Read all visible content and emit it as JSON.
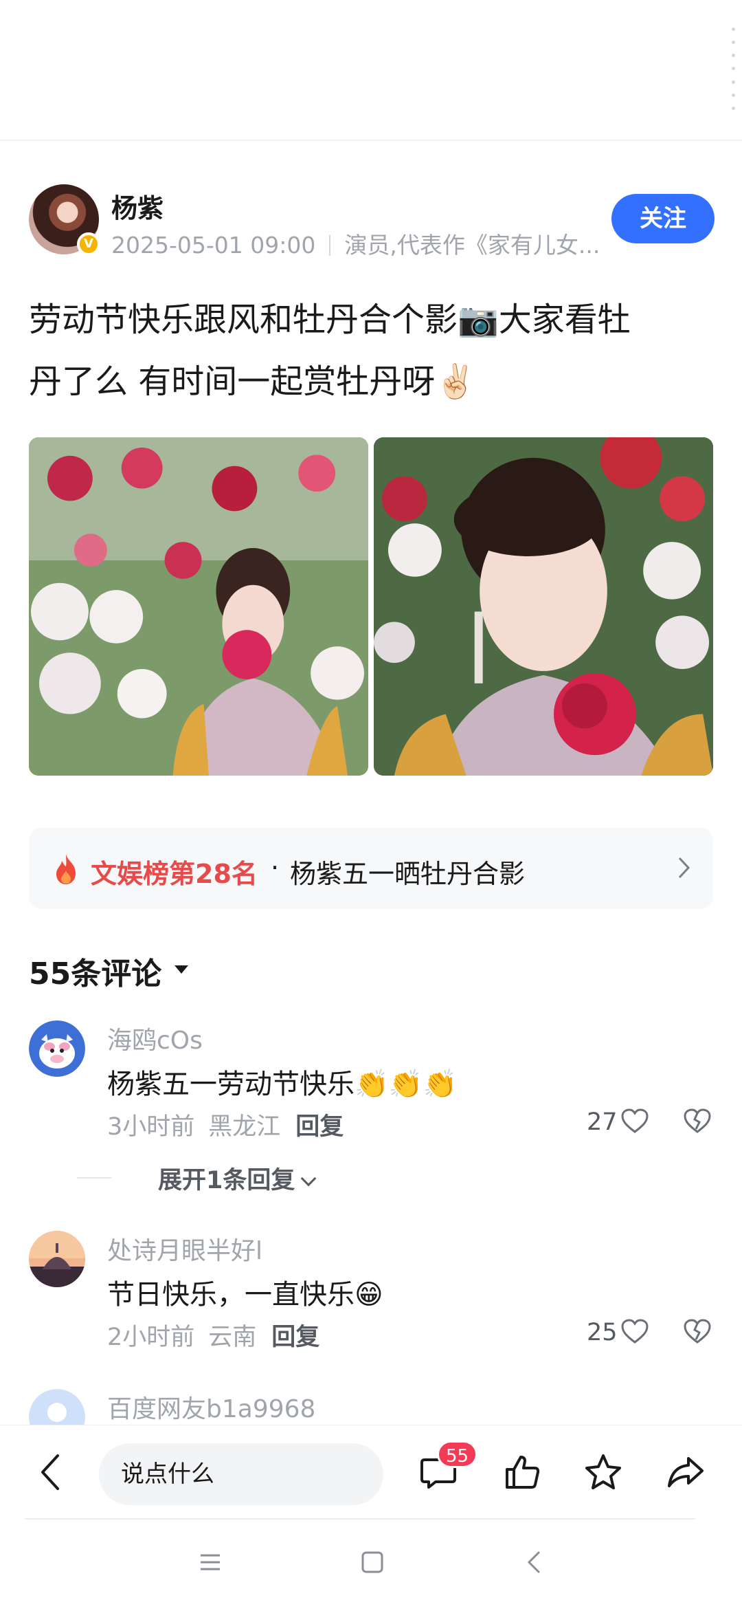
{
  "author": {
    "name": "杨紫",
    "timestamp": "2025-05-01 09:00",
    "description": "演员,代表作《家有儿女...",
    "follow_label": "关注",
    "verified_icon": "verified-badge-icon"
  },
  "post": {
    "text_line1": "劳动节快乐跟风和牡丹合个影📷大家看牡",
    "text_line2": "丹了么 有时间一起赏牡丹呀✌🏻"
  },
  "hot": {
    "rank_label": "文娱榜第28名",
    "separator": "·",
    "topic": "杨紫五一晒牡丹合影"
  },
  "comments_section": {
    "title": "55条评论",
    "expand_label": "展开1条回复"
  },
  "comments": [
    {
      "user": "海鸥cOs",
      "text": "杨紫五一劳动节快乐👏👏👏",
      "time": "3小时前",
      "location": "黑龙江",
      "reply_label": "回复",
      "likes": "27"
    },
    {
      "user": "处诗月眼半好l",
      "text": "节日快乐，一直快乐😁",
      "time": "2小时前",
      "location": "云南",
      "reply_label": "回复",
      "likes": "25"
    },
    {
      "user": "百度网友b1a9968"
    }
  ],
  "bottom_bar": {
    "input_placeholder": "说点什么",
    "comment_count_badge": "55"
  },
  "colors": {
    "accent": "#3370ff",
    "hot_red": "#e84a4a",
    "badge_red": "#f23b55"
  }
}
